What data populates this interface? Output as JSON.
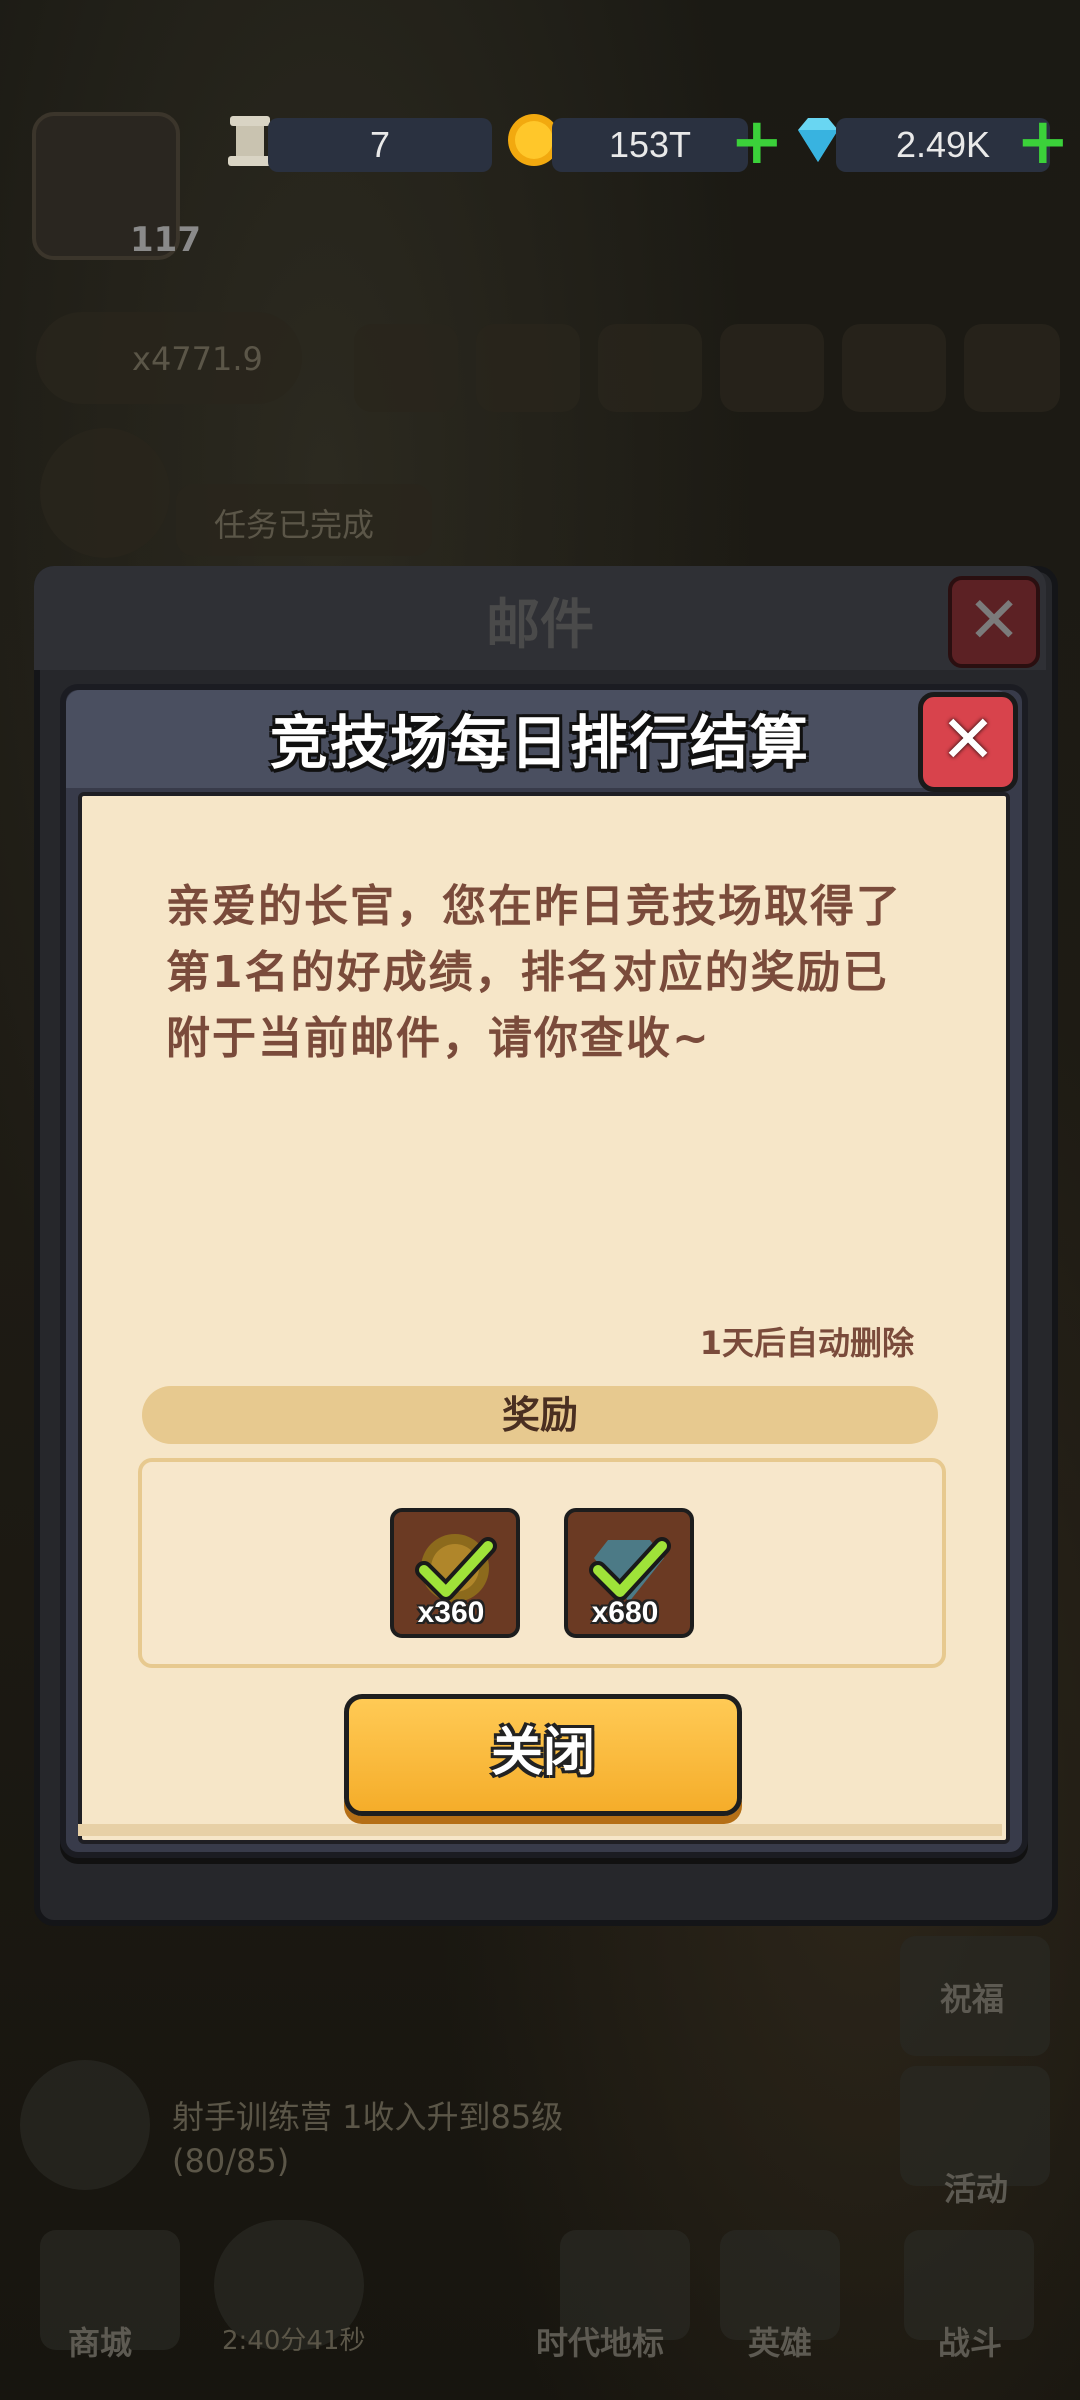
{
  "top_bar": {
    "relic_count": "7",
    "coin_count": "153T",
    "gem_count": "2.49K",
    "relic_icon": "pillar-icon",
    "coin_icon": "gold-coin-icon",
    "gem_icon": "diamond-icon",
    "plus_icon": "plus-icon"
  },
  "player": {
    "level": "117"
  },
  "background": {
    "multiplier": "x4771.9",
    "task_status": "任务已完成",
    "promo_text": "射手训练营 1收入升到85级",
    "promo_progress": "(80/85)",
    "double_timer": "2:40分41秒",
    "side_labels": [
      "祝福",
      "活动"
    ],
    "nav": [
      "商城",
      "时代地标",
      "英雄",
      "战斗"
    ]
  },
  "mail_window": {
    "title": "邮件"
  },
  "dialog": {
    "title": "竞技场每日排行结算",
    "message": "亲爱的长官，您在昨日竞技场取得了第1名的好成绩，排名对应的奖励已附于当前邮件，请你查收~",
    "expire_text": "1天后自动删除",
    "reward_header": "奖励",
    "rewards": [
      {
        "icon": "gold-coin-icon",
        "quantity": "x360"
      },
      {
        "icon": "diamond-icon",
        "quantity": "x680"
      }
    ],
    "close_label": "关闭"
  },
  "colors": {
    "accent_button": "#f5ad2a",
    "close_red": "#d8434c",
    "paper": "#f6e6c8",
    "text_brown": "#7a4b3b",
    "plus_green": "#3bd13a"
  }
}
